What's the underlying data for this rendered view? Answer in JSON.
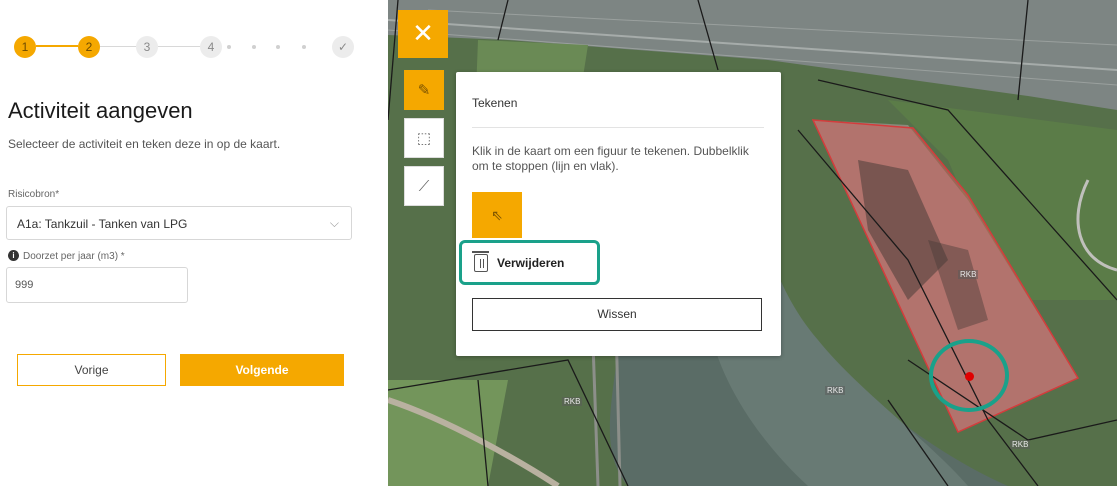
{
  "stepper": {
    "steps": [
      "1",
      "2",
      "3",
      "4",
      "✓"
    ],
    "active_steps": 2
  },
  "form": {
    "title": "Activiteit aangeven",
    "subtitle": "Selecteer de activiteit en teken deze in op de kaart.",
    "risk_source_label": "Risicobron*",
    "risk_source_value": "A1a: Tankzuil - Tanken van LPG",
    "throughput_label": "Doorzet per jaar (m3) *",
    "throughput_value": "999"
  },
  "buttons": {
    "prev": "Vorige",
    "next": "Volgende"
  },
  "map": {
    "toolbar": {
      "close": "✕",
      "tools": [
        "pencil-icon",
        "cube-icon",
        "ruler-icon"
      ]
    },
    "popup": {
      "title": "Tekenen",
      "instructions": "Klik in de kaart om een figuur te tekenen. Dubbelklik om te stoppen (lijn en vlak).",
      "delete_label": "Verwijderen",
      "clear_label": "Wissen"
    },
    "labels": [
      "RKB",
      "RKB",
      "RKB",
      "RKB"
    ],
    "colors": {
      "accent": "#f5a800",
      "highlight": "#1aa18a",
      "polygon": "#d46060",
      "marker": "#e00000"
    }
  }
}
